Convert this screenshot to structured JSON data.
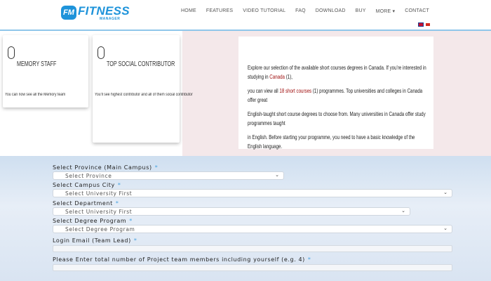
{
  "brand": {
    "mark": "FM",
    "name": "FITNESS",
    "sub": "MANAGER"
  },
  "nav": [
    {
      "label": "HOME"
    },
    {
      "label": "FEATURES"
    },
    {
      "label": "VIDEO TUTORIAL"
    },
    {
      "label": "FAQ"
    },
    {
      "label": "DOWNLOAD"
    },
    {
      "label": "BUY"
    },
    {
      "label": "MORE ▾"
    },
    {
      "label": "CONTACT"
    }
  ],
  "cards": [
    {
      "title": "MEMORY STAFF",
      "text": "You can now see all the Memory team"
    },
    {
      "title": "TOP SOCIAL CONTRIBUTOR",
      "text": "You'll see highest contributor and all of them social contributor"
    }
  ],
  "info": {
    "p1_a": "Explore our selection of the available short courses degrees in Canada. If you're interested in studying in ",
    "p1_b": "Canada",
    "p1_c": " (1),",
    "p2_a": "you can view all ",
    "p2_b": "18 short courses",
    "p2_c": " (1) programmes. Top universities and colleges in Canada offer great",
    "p3": "English-taught short course degrees to choose from. Many universities in Canada offer study programmes taught",
    "p4": "in English. Before starting your programme, you need to have a basic knowledge of the English language."
  },
  "form": {
    "province_label": "Select Province (Main Campus)",
    "province_value": "Select Province",
    "city_label": "Select Campus City",
    "city_value": "Select University First",
    "dept_label": "Select Department",
    "dept_value": "Select University First",
    "degree_label": "Select Degree Program",
    "degree_value": "Select Degree Program",
    "email_label": "Login Email (Team Lead)",
    "members_label": "Please Enter total number of Project team members including yourself (e.g. 4)",
    "required_mark": "*"
  },
  "colors": {
    "accent": "#1e93da",
    "highlight": "#a01010",
    "panel": "#f4e8ea"
  }
}
